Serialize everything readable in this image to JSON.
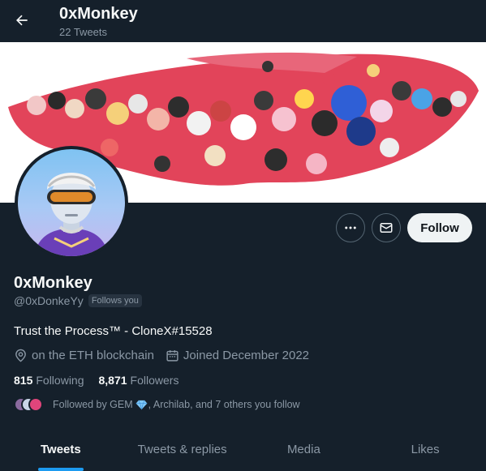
{
  "header": {
    "title": "0xMonkey",
    "subtitle": "22 Tweets",
    "back_icon": "arrow-left-icon"
  },
  "banner": {
    "kind": "illustration"
  },
  "actions": {
    "more_icon": "more-horizontal-icon",
    "message_icon": "envelope-icon",
    "follow_label": "Follow"
  },
  "profile": {
    "name": "0xMonkey",
    "handle": "@0xDonkeYy",
    "follows_you": "Follows you",
    "bio": "Trust the Process™ - CloneX#15528",
    "location": "on the ETH blockchain",
    "joined": "Joined December 2022",
    "following_count": "815",
    "following_label": "Following",
    "followers_count": "8,871",
    "followers_label": "Followers",
    "followed_by_prefix": "Followed by GEM",
    "followed_by_suffix": ", Archilab, and 7 others you follow"
  },
  "tabs": [
    {
      "label": "Tweets",
      "active": true
    },
    {
      "label": "Tweets & replies",
      "active": false
    },
    {
      "label": "Media",
      "active": false
    },
    {
      "label": "Likes",
      "active": false
    }
  ],
  "colors": {
    "background": "#15202b",
    "accent": "#1d9bf0",
    "muted_text": "#8b98a5"
  }
}
